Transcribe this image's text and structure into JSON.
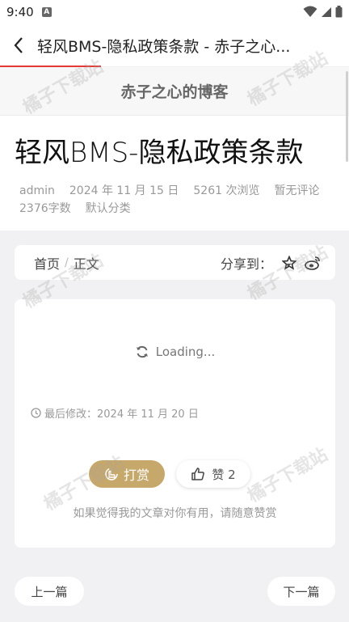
{
  "status_bar": {
    "time": "9:40",
    "app_badge": "A"
  },
  "app_bar": {
    "title": "轻风BMS-隐私政策条款 - 赤子之心..."
  },
  "site": {
    "name": "赤子之心的博客"
  },
  "article": {
    "title": "轻风BMS-隐私政策条款",
    "author": "admin",
    "date": "2024 年 11 月 15 日",
    "views": "5261 次浏览",
    "comments": "暂无评论",
    "word_count": "2376字数",
    "category": "默认分类"
  },
  "breadcrumb": {
    "home": "首页",
    "current": "正文",
    "share_label": "分享到："
  },
  "content": {
    "loading_text": "Loading...",
    "last_modified": "最后修改：2024 年 11 月 20 日",
    "reward_label": "打赏",
    "like_label": "赞 2",
    "thanks_text": "如果觉得我的文章对你有用，请随意赞赏"
  },
  "navigation": {
    "prev_label": "上一篇",
    "next_label": "下一篇"
  },
  "watermark": {
    "text": "橘子下载站"
  },
  "colors": {
    "accent_gold": "#c7a86b",
    "progress_red": "#e53935"
  }
}
